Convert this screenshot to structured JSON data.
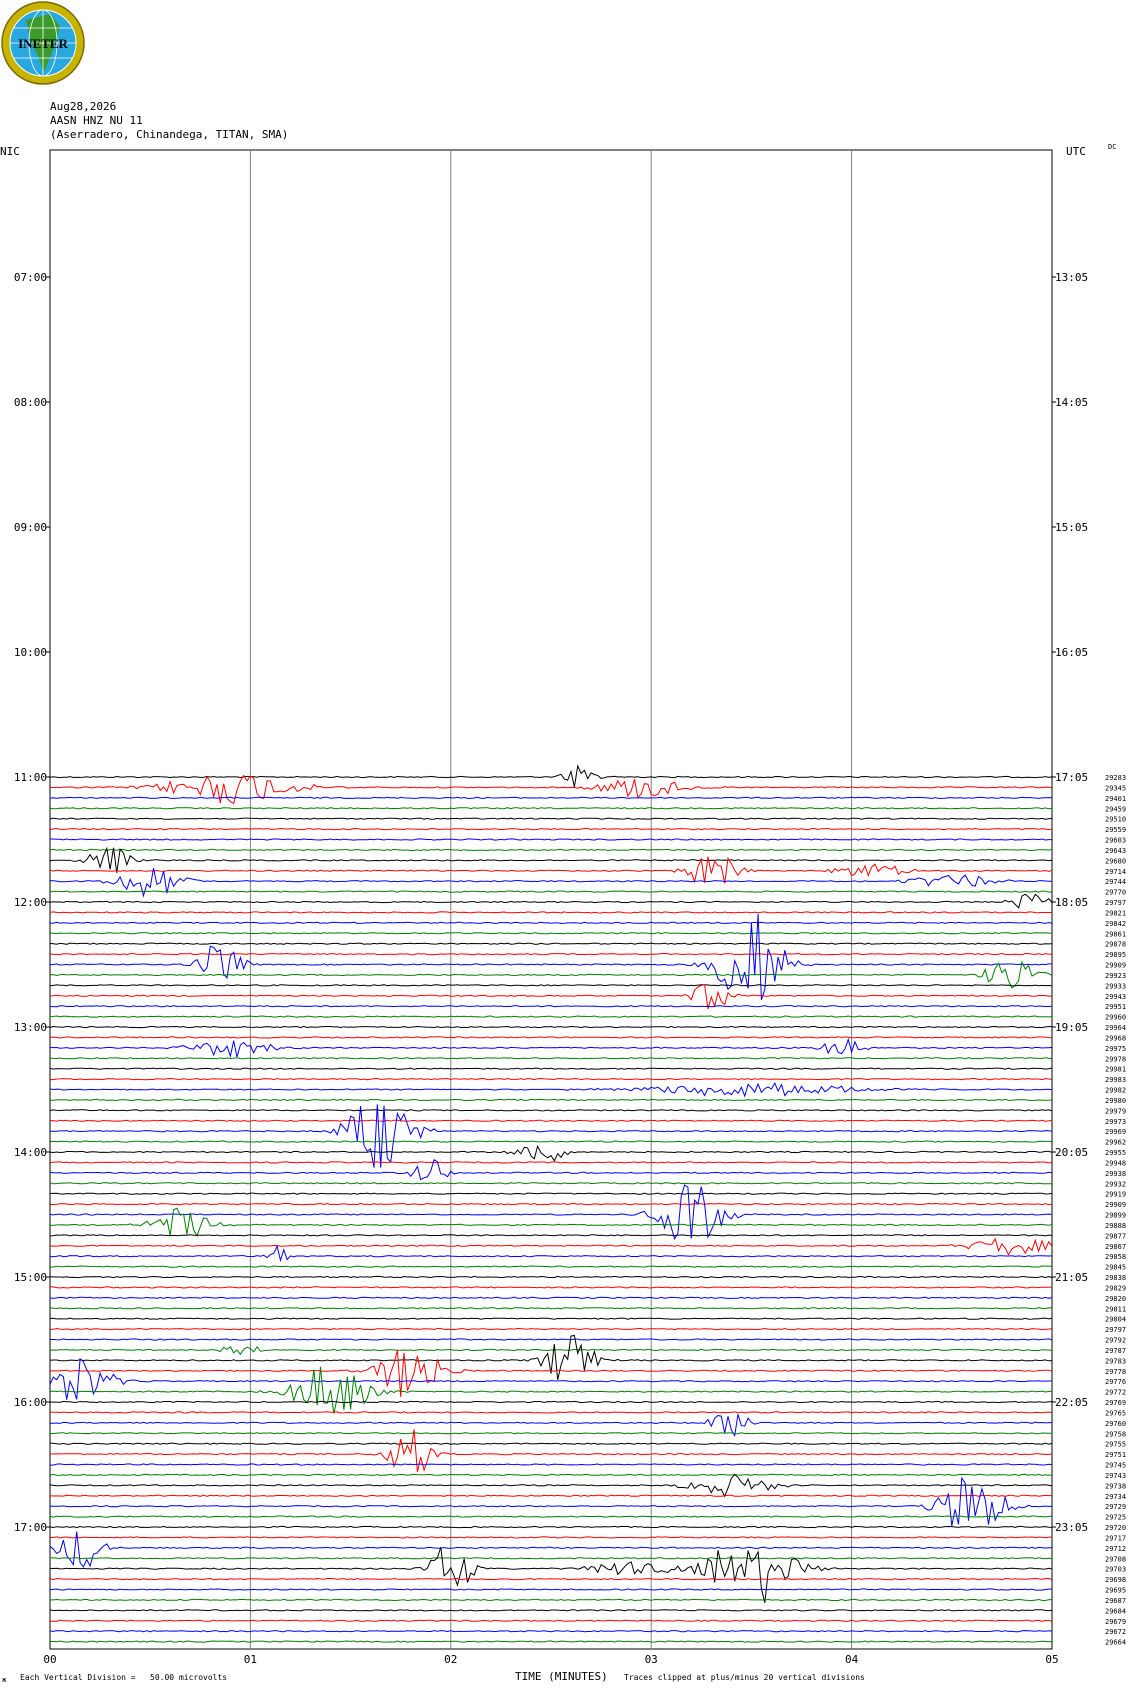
{
  "logo": {
    "text": "INETER",
    "colors": {
      "ring": "#c8b400",
      "globe": "#29a8e0",
      "land": "#3c9a2c",
      "grid": "#ffffff",
      "text": "#000000"
    }
  },
  "header": {
    "date": "Aug28,2026",
    "station": "AASN HNZ NU 11",
    "location": "(Aserradero, Chinandega, TITAN, SMA)"
  },
  "labels": {
    "left_tz": "NIC",
    "right_tz": "UTC",
    "dc": "DC",
    "xlabel": "TIME (MINUTES)",
    "scale_note": "Each Vertical Division =   50.00 microvolts",
    "clip_note": "Traces clipped at plus/minus 20 vertical divisions",
    "corner_mark": "ж"
  },
  "colors": {
    "trace_cycle": [
      "#000000",
      "#ff0000",
      "#0000ff",
      "#008000"
    ],
    "grid": "#808080"
  },
  "chart_data": {
    "type": "line",
    "title": "",
    "xlabel": "TIME (MINUTES)",
    "ylabel": "",
    "xlim": [
      0,
      5
    ],
    "x_ticks": [
      "00",
      "01",
      "02",
      "03",
      "04",
      "05"
    ],
    "time_rows_nic": [
      "07:00",
      "08:00",
      "09:00",
      "10:00",
      "11:00",
      "12:00",
      "13:00",
      "14:00",
      "15:00",
      "16:00",
      "17:00"
    ],
    "time_rows_utc": [
      "13:05",
      "14:05",
      "15:05",
      "16:05",
      "17:05",
      "18:05",
      "19:05",
      "20:05",
      "21:05",
      "22:05",
      "23:05"
    ],
    "trace_start_hour_index": 4,
    "trace_count": 84,
    "trace_labels": [
      "29283",
      "29345",
      "29401",
      "29459",
      "29510",
      "29559",
      "29603",
      "29643",
      "29680",
      "29714",
      "29744",
      "29770",
      "29797",
      "29821",
      "29842",
      "29861",
      "29878",
      "29895",
      "29909",
      "29923",
      "29933",
      "29943",
      "29951",
      "29960",
      "29964",
      "29968",
      "29975",
      "29978",
      "29981",
      "29983",
      "29982",
      "29980",
      "29979",
      "29973",
      "29969",
      "29962",
      "29955",
      "29948",
      "29938",
      "29932",
      "29919",
      "29909",
      "29899",
      "29888",
      "29877",
      "29867",
      "29858",
      "29845",
      "29838",
      "29829",
      "29820",
      "29811",
      "29804",
      "29797",
      "29792",
      "29787",
      "29783",
      "29778",
      "29776",
      "29772",
      "29769",
      "29765",
      "29760",
      "29758",
      "29755",
      "29751",
      "29745",
      "29743",
      "29738",
      "29734",
      "29729",
      "29725",
      "29720",
      "29717",
      "29712",
      "29708",
      "29703",
      "29698",
      "29695",
      "29687",
      "29684",
      "29679",
      "29672",
      "29664"
    ],
    "events": [
      {
        "trace": 0,
        "minute": 2.65,
        "amp": 1.5,
        "width": 0.08
      },
      {
        "trace": 1,
        "minute": 0.9,
        "amp": 1.8,
        "width": 0.3
      },
      {
        "trace": 1,
        "minute": 2.95,
        "amp": 1.2,
        "width": 0.2
      },
      {
        "trace": 8,
        "minute": 0.3,
        "amp": 1.6,
        "width": 0.12
      },
      {
        "trace": 9,
        "minute": 3.3,
        "amp": 2.2,
        "width": 0.12
      },
      {
        "trace": 9,
        "minute": 4.1,
        "amp": 1.0,
        "width": 0.15
      },
      {
        "trace": 10,
        "minute": 0.5,
        "amp": 1.8,
        "width": 0.15
      },
      {
        "trace": 10,
        "minute": 4.5,
        "amp": 0.8,
        "width": 0.2
      },
      {
        "trace": 12,
        "minute": 4.9,
        "amp": 1.0,
        "width": 0.1
      },
      {
        "trace": 18,
        "minute": 0.85,
        "amp": 2.5,
        "width": 0.1
      },
      {
        "trace": 18,
        "minute": 3.5,
        "amp": 6.0,
        "width": 0.15
      },
      {
        "trace": 19,
        "minute": 4.8,
        "amp": 2.0,
        "width": 0.12
      },
      {
        "trace": 21,
        "minute": 3.3,
        "amp": 1.5,
        "width": 0.1
      },
      {
        "trace": 26,
        "minute": 0.9,
        "amp": 1.0,
        "width": 0.2
      },
      {
        "trace": 26,
        "minute": 3.95,
        "amp": 1.0,
        "width": 0.1
      },
      {
        "trace": 30,
        "minute": 3.5,
        "amp": 0.8,
        "width": 0.5
      },
      {
        "trace": 34,
        "minute": 1.65,
        "amp": 4.5,
        "width": 0.15
      },
      {
        "trace": 36,
        "minute": 2.45,
        "amp": 1.3,
        "width": 0.12
      },
      {
        "trace": 38,
        "minute": 1.9,
        "amp": 1.5,
        "width": 0.08
      },
      {
        "trace": 42,
        "minute": 3.2,
        "amp": 3.5,
        "width": 0.15
      },
      {
        "trace": 43,
        "minute": 0.65,
        "amp": 1.8,
        "width": 0.15
      },
      {
        "trace": 45,
        "minute": 4.8,
        "amp": 1.0,
        "width": 0.2
      },
      {
        "trace": 46,
        "minute": 1.15,
        "amp": 1.2,
        "width": 0.05
      },
      {
        "trace": 55,
        "minute": 0.95,
        "amp": 0.8,
        "width": 0.1
      },
      {
        "trace": 56,
        "minute": 2.6,
        "amp": 3.0,
        "width": 0.12
      },
      {
        "trace": 57,
        "minute": 1.8,
        "amp": 3.2,
        "width": 0.15
      },
      {
        "trace": 58,
        "minute": 0.1,
        "amp": 3.0,
        "width": 0.18
      },
      {
        "trace": 59,
        "minute": 1.4,
        "amp": 3.0,
        "width": 0.18
      },
      {
        "trace": 62,
        "minute": 3.4,
        "amp": 1.5,
        "width": 0.1
      },
      {
        "trace": 65,
        "minute": 1.8,
        "amp": 3.0,
        "width": 0.1
      },
      {
        "trace": 68,
        "minute": 3.4,
        "amp": 1.2,
        "width": 0.2
      },
      {
        "trace": 70,
        "minute": 4.6,
        "amp": 3.5,
        "width": 0.15
      },
      {
        "trace": 74,
        "minute": 0.15,
        "amp": 2.5,
        "width": 0.1
      },
      {
        "trace": 76,
        "minute": 2.0,
        "amp": 3.0,
        "width": 0.1
      },
      {
        "trace": 76,
        "minute": 3.5,
        "amp": 4.5,
        "width": 0.2
      },
      {
        "trace": 76,
        "minute": 2.9,
        "amp": 0.8,
        "width": 0.2
      }
    ]
  }
}
